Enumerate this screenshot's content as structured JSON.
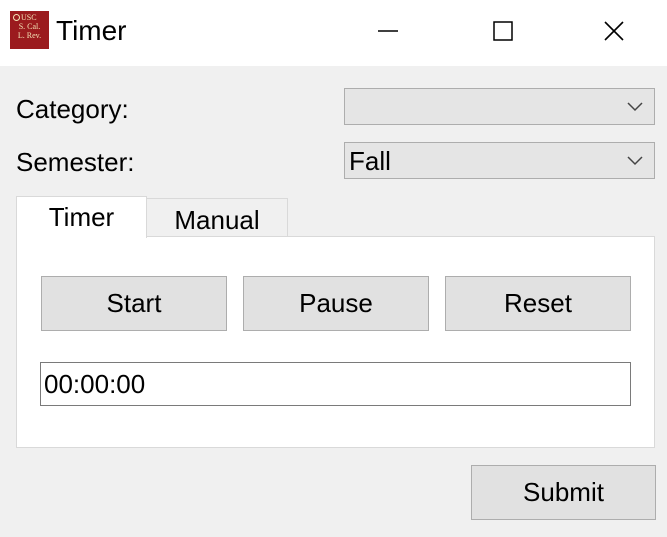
{
  "window": {
    "title": "Timer",
    "logo": {
      "line1": "USC",
      "line2": "S. Cal.",
      "line3": "L. Rev."
    },
    "controls": [
      "minimize-icon",
      "maximize-icon",
      "close-icon"
    ]
  },
  "form": {
    "category_label": "Category:",
    "category_value": "",
    "semester_label": "Semester:",
    "semester_value": "Fall"
  },
  "tabs": [
    {
      "label": "Timer",
      "active": true
    },
    {
      "label": "Manual",
      "active": false
    }
  ],
  "timer": {
    "start_label": "Start",
    "pause_label": "Pause",
    "reset_label": "Reset",
    "display": "00:00:00"
  },
  "footer": {
    "submit_label": "Submit"
  },
  "colors": {
    "logo_bg": "#9b1b1e",
    "window_bg": "#f0f0f0",
    "button_bg": "#e1e1e1"
  }
}
